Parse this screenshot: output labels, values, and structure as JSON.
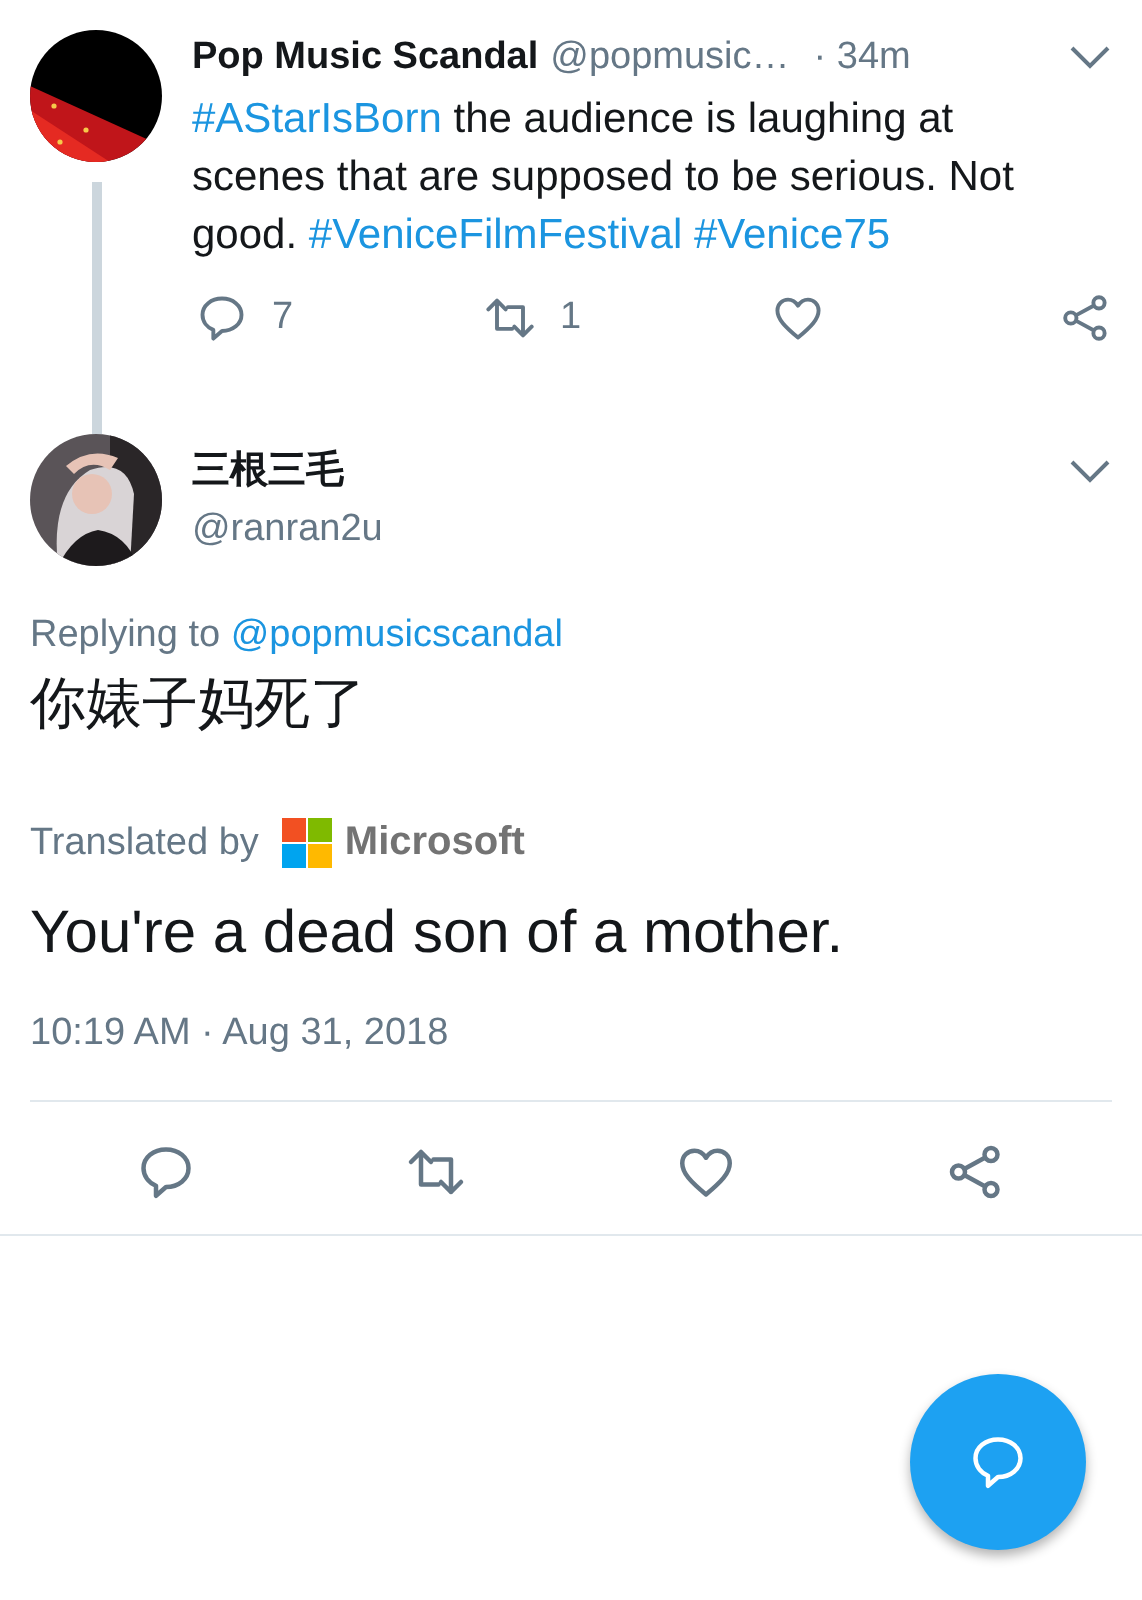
{
  "parent_tweet": {
    "name": "Pop Music Scandal",
    "handle": "@popmusic…",
    "time": "· 34m",
    "text": [
      {
        "kind": "hashtag",
        "text": "#AStarIsBorn"
      },
      {
        "kind": "text",
        "text": " the audience is laughing at scenes that are supposed to be serious. Not good. "
      },
      {
        "kind": "hashtag",
        "text": "#VeniceFilmFestival"
      },
      {
        "kind": "hashtag",
        "text": "#Venice75"
      }
    ],
    "actions": [
      {
        "kind": "reply",
        "count": "7"
      },
      {
        "kind": "retweet",
        "count": "1"
      },
      {
        "kind": "like"
      },
      {
        "kind": "share"
      }
    ]
  },
  "tweet": {
    "name": "三根三毛",
    "handle": "@ranran2u",
    "replying_label": "Replying to",
    "replying_to": "@popmusicscandal",
    "text": "你婊子妈死了",
    "translated_by": "Translated by",
    "translator": "Microsoft",
    "translation": "You're a dead son of a mother.",
    "timestamp": "10:19 AM · Aug 31, 2018",
    "actions": [
      {
        "kind": "reply"
      },
      {
        "kind": "retweet"
      },
      {
        "kind": "like"
      },
      {
        "kind": "share"
      }
    ]
  }
}
